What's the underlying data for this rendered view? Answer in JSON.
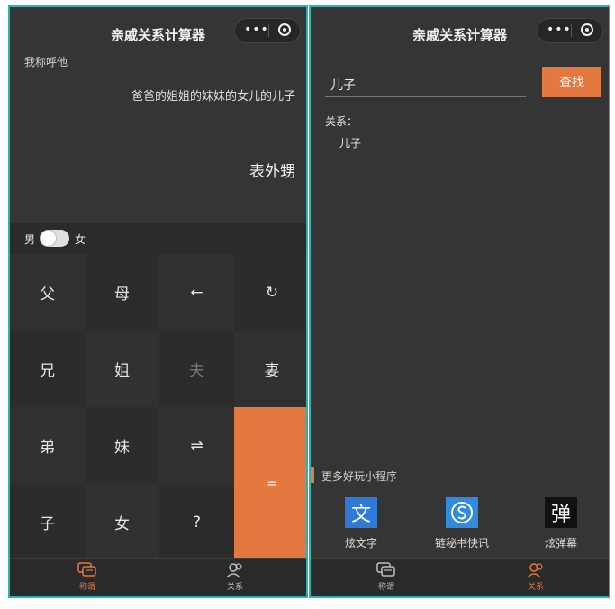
{
  "left": {
    "title": "亲戚关系计算器",
    "caption": "我称呼他",
    "expression": "爸爸的姐姐的妹妹的女儿的儿子",
    "result": "表外甥",
    "gender": {
      "male": "男",
      "female": "女",
      "selected": "male"
    },
    "keys": [
      "父",
      "母",
      "←",
      "↻",
      "兄",
      "姐",
      "夫",
      "妻",
      "弟",
      "妹",
      "⇌",
      "=",
      "子",
      "女",
      "?"
    ],
    "tabs": [
      {
        "label": "称谓",
        "active": true
      },
      {
        "label": "关系",
        "active": false
      }
    ]
  },
  "right": {
    "title": "亲戚关系计算器",
    "search": {
      "value": "儿子",
      "button": "查找"
    },
    "relation_label": "关系：",
    "relation_value": "儿子",
    "more_title": "更多好玩小程序",
    "apps": [
      {
        "label": "炫文字",
        "icon": "wen-icon",
        "glyph": "文",
        "color": "#2f7ad8"
      },
      {
        "label": "链秘书快讯",
        "icon": "s-logo-icon",
        "glyph": "S",
        "color": "#2f8be0"
      },
      {
        "label": "炫弹幕",
        "icon": "dan-icon",
        "glyph": "弹",
        "color": "#111111"
      }
    ],
    "tabs": [
      {
        "label": "称谓",
        "active": false
      },
      {
        "label": "关系",
        "active": true
      }
    ]
  },
  "colors": {
    "accent": "#e37941",
    "panel": "#353535",
    "frame": "#2bb3b0"
  }
}
